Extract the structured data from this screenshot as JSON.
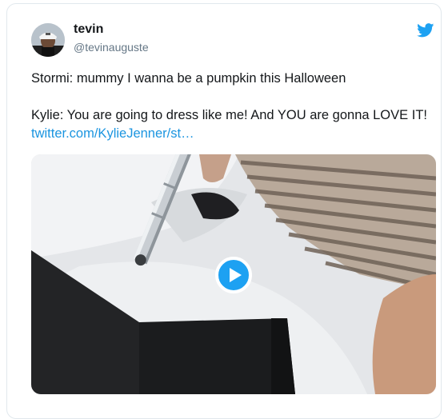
{
  "user": {
    "name": "tevin",
    "handle": "@tevinauguste",
    "avatar_icon": "avatar-photo"
  },
  "brand": {
    "icon": "twitter-bird-icon",
    "color": "#1da1f2"
  },
  "tweet": {
    "line1": "Stormi: mummy I wanna be a pumpkin this Halloween",
    "line2": "Kylie: You are going to dress like me! And YOU are gonna LOVE IT!",
    "link": "twitter.com/KylieJenner/st…",
    "link_color": "#1b95e0"
  },
  "media": {
    "type": "video",
    "play_icon": "play-icon",
    "play_color": "#1da1f2"
  }
}
